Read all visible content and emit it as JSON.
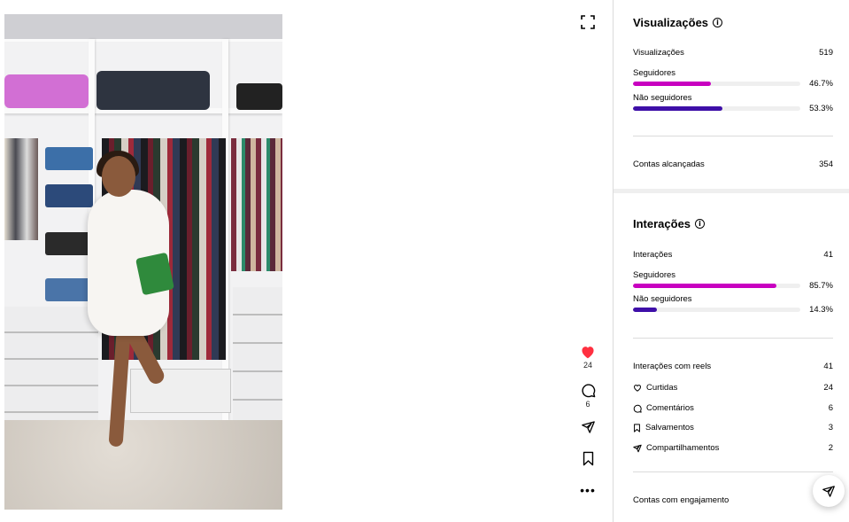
{
  "post": {
    "likes_count": "24",
    "comments_count": "6"
  },
  "views": {
    "title": "Visualizações",
    "total_label": "Visualizações",
    "total_value": "519",
    "followers_label": "Seguidores",
    "followers_pct": "46.7%",
    "followers_fraction": 0.467,
    "nonfollowers_label": "Não seguidores",
    "nonfollowers_pct": "53.3%",
    "nonfollowers_fraction": 0.533,
    "accounts_reached_label": "Contas alcançadas",
    "accounts_reached_value": "354"
  },
  "interactions": {
    "title": "Interações",
    "total_label": "Interações",
    "total_value": "41",
    "followers_label": "Seguidores",
    "followers_pct": "85.7%",
    "followers_fraction": 0.857,
    "nonfollowers_label": "Não seguidores",
    "nonfollowers_pct": "14.3%",
    "nonfollowers_fraction": 0.143,
    "reels_label": "Interações com reels",
    "reels_value": "41",
    "items": [
      {
        "icon": "heart-icon",
        "label": "Curtidas",
        "value": "24"
      },
      {
        "icon": "comment-icon",
        "label": "Comentários",
        "value": "6"
      },
      {
        "icon": "bookmark-icon",
        "label": "Salvamentos",
        "value": "3"
      },
      {
        "icon": "send-icon",
        "label": "Compartilhamentos",
        "value": "2"
      }
    ],
    "engaged_accounts_label": "Contas com engajamento"
  },
  "colors": {
    "followers_bar": "#c800c0",
    "nonfollowers_bar": "#3e0fa8",
    "like_red": "#ff3040"
  }
}
